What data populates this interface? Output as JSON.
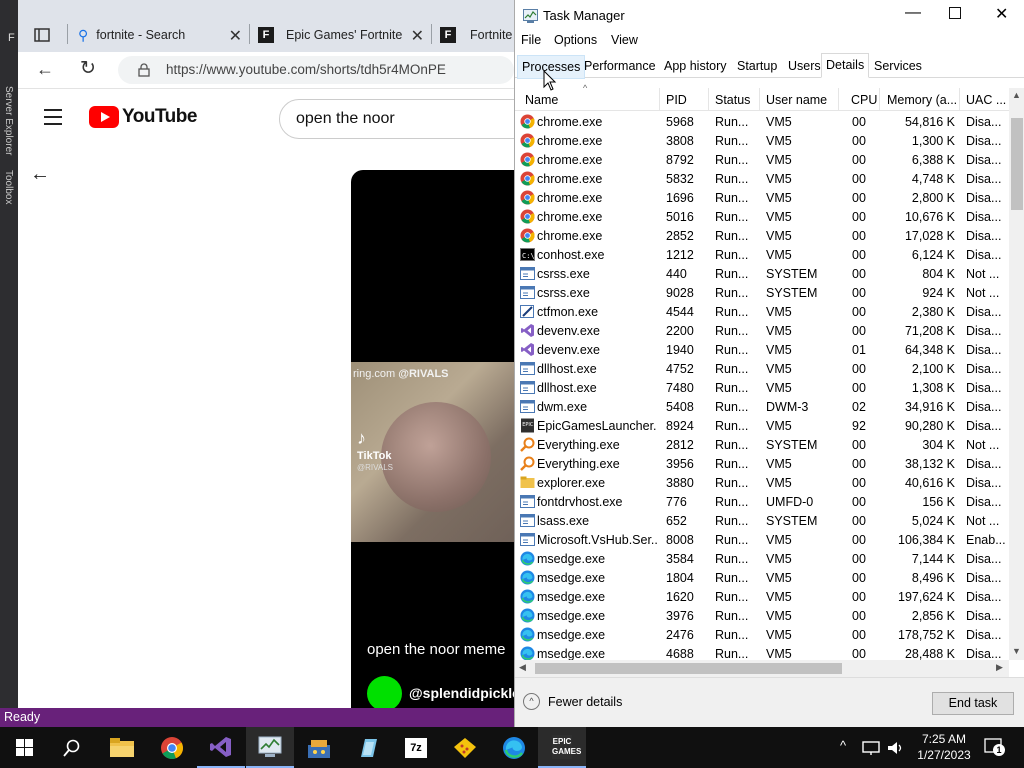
{
  "vs": {
    "side_labels": [
      "Server Explorer",
      "Toolbox"
    ],
    "partial_menu": "F"
  },
  "browser": {
    "tabs": [
      {
        "label": "fortnite - Search",
        "icon": "search-icon"
      },
      {
        "label": "Epic Games' Fortnite",
        "icon": "fortnite-icon"
      },
      {
        "label": "Fortnite",
        "icon": "fortnite-icon"
      }
    ],
    "url": "https://www.youtube.com/shorts/tdh5r4MOnPE",
    "youtube": {
      "logo": "YouTube",
      "search_value": "open the noor",
      "short_caption": "open the noor meme",
      "short_user": "@splendidpickle",
      "watermark_site": "ring.com",
      "watermark_handle": "@RIVALS",
      "tiktok_label": "TikTok",
      "tiktok_handle": "@RIVALS"
    }
  },
  "taskmanager": {
    "title": "Task Manager",
    "menu": [
      "File",
      "Options",
      "View"
    ],
    "tabs": [
      "Processes",
      "Performance",
      "App history",
      "Startup",
      "Users",
      "Details",
      "Services"
    ],
    "active_tab": "Details",
    "columns": [
      "Name",
      "PID",
      "Status",
      "User name",
      "CPU",
      "Memory (a...",
      "UAC ..."
    ],
    "rows": [
      {
        "icon": "chrome",
        "name": "chrome.exe",
        "pid": "5968",
        "status": "Run...",
        "user": "VM5",
        "cpu": "00",
        "mem": "54,816 K",
        "uac": "Disa..."
      },
      {
        "icon": "chrome",
        "name": "chrome.exe",
        "pid": "3808",
        "status": "Run...",
        "user": "VM5",
        "cpu": "00",
        "mem": "1,300 K",
        "uac": "Disa..."
      },
      {
        "icon": "chrome",
        "name": "chrome.exe",
        "pid": "8792",
        "status": "Run...",
        "user": "VM5",
        "cpu": "00",
        "mem": "6,388 K",
        "uac": "Disa..."
      },
      {
        "icon": "chrome",
        "name": "chrome.exe",
        "pid": "5832",
        "status": "Run...",
        "user": "VM5",
        "cpu": "00",
        "mem": "4,748 K",
        "uac": "Disa..."
      },
      {
        "icon": "chrome",
        "name": "chrome.exe",
        "pid": "1696",
        "status": "Run...",
        "user": "VM5",
        "cpu": "00",
        "mem": "2,800 K",
        "uac": "Disa..."
      },
      {
        "icon": "chrome",
        "name": "chrome.exe",
        "pid": "5016",
        "status": "Run...",
        "user": "VM5",
        "cpu": "00",
        "mem": "10,676 K",
        "uac": "Disa..."
      },
      {
        "icon": "chrome",
        "name": "chrome.exe",
        "pid": "2852",
        "status": "Run...",
        "user": "VM5",
        "cpu": "00",
        "mem": "17,028 K",
        "uac": "Disa..."
      },
      {
        "icon": "console",
        "name": "conhost.exe",
        "pid": "1212",
        "status": "Run...",
        "user": "VM5",
        "cpu": "00",
        "mem": "6,124 K",
        "uac": "Disa..."
      },
      {
        "icon": "window",
        "name": "csrss.exe",
        "pid": "440",
        "status": "Run...",
        "user": "SYSTEM",
        "cpu": "00",
        "mem": "804 K",
        "uac": "Not ..."
      },
      {
        "icon": "window",
        "name": "csrss.exe",
        "pid": "9028",
        "status": "Run...",
        "user": "SYSTEM",
        "cpu": "00",
        "mem": "924 K",
        "uac": "Not ..."
      },
      {
        "icon": "pen",
        "name": "ctfmon.exe",
        "pid": "4544",
        "status": "Run...",
        "user": "VM5",
        "cpu": "00",
        "mem": "2,380 K",
        "uac": "Disa..."
      },
      {
        "icon": "vs",
        "name": "devenv.exe",
        "pid": "2200",
        "status": "Run...",
        "user": "VM5",
        "cpu": "00",
        "mem": "71,208 K",
        "uac": "Disa..."
      },
      {
        "icon": "vs",
        "name": "devenv.exe",
        "pid": "1940",
        "status": "Run...",
        "user": "VM5",
        "cpu": "01",
        "mem": "64,348 K",
        "uac": "Disa..."
      },
      {
        "icon": "window",
        "name": "dllhost.exe",
        "pid": "4752",
        "status": "Run...",
        "user": "VM5",
        "cpu": "00",
        "mem": "2,100 K",
        "uac": "Disa..."
      },
      {
        "icon": "window",
        "name": "dllhost.exe",
        "pid": "7480",
        "status": "Run...",
        "user": "VM5",
        "cpu": "00",
        "mem": "1,308 K",
        "uac": "Disa..."
      },
      {
        "icon": "window",
        "name": "dwm.exe",
        "pid": "5408",
        "status": "Run...",
        "user": "DWM-3",
        "cpu": "02",
        "mem": "34,916 K",
        "uac": "Disa..."
      },
      {
        "icon": "epic",
        "name": "EpicGamesLauncher....",
        "pid": "8924",
        "status": "Run...",
        "user": "VM5",
        "cpu": "92",
        "mem": "90,280 K",
        "uac": "Disa..."
      },
      {
        "icon": "search",
        "name": "Everything.exe",
        "pid": "2812",
        "status": "Run...",
        "user": "SYSTEM",
        "cpu": "00",
        "mem": "304 K",
        "uac": "Not ..."
      },
      {
        "icon": "search",
        "name": "Everything.exe",
        "pid": "3956",
        "status": "Run...",
        "user": "VM5",
        "cpu": "00",
        "mem": "38,132 K",
        "uac": "Disa..."
      },
      {
        "icon": "folder",
        "name": "explorer.exe",
        "pid": "3880",
        "status": "Run...",
        "user": "VM5",
        "cpu": "00",
        "mem": "40,616 K",
        "uac": "Disa..."
      },
      {
        "icon": "window",
        "name": "fontdrvhost.exe",
        "pid": "776",
        "status": "Run...",
        "user": "UMFD-0",
        "cpu": "00",
        "mem": "156 K",
        "uac": "Disa..."
      },
      {
        "icon": "window",
        "name": "lsass.exe",
        "pid": "652",
        "status": "Run...",
        "user": "SYSTEM",
        "cpu": "00",
        "mem": "5,024 K",
        "uac": "Not ..."
      },
      {
        "icon": "window",
        "name": "Microsoft.VsHub.Ser...",
        "pid": "8008",
        "status": "Run...",
        "user": "VM5",
        "cpu": "00",
        "mem": "106,384 K",
        "uac": "Enab..."
      },
      {
        "icon": "edge",
        "name": "msedge.exe",
        "pid": "3584",
        "status": "Run...",
        "user": "VM5",
        "cpu": "00",
        "mem": "7,144 K",
        "uac": "Disa..."
      },
      {
        "icon": "edge",
        "name": "msedge.exe",
        "pid": "1804",
        "status": "Run...",
        "user": "VM5",
        "cpu": "00",
        "mem": "8,496 K",
        "uac": "Disa..."
      },
      {
        "icon": "edge",
        "name": "msedge.exe",
        "pid": "1620",
        "status": "Run...",
        "user": "VM5",
        "cpu": "00",
        "mem": "197,624 K",
        "uac": "Disa..."
      },
      {
        "icon": "edge",
        "name": "msedge.exe",
        "pid": "3976",
        "status": "Run...",
        "user": "VM5",
        "cpu": "00",
        "mem": "2,856 K",
        "uac": "Disa..."
      },
      {
        "icon": "edge",
        "name": "msedge.exe",
        "pid": "2476",
        "status": "Run...",
        "user": "VM5",
        "cpu": "00",
        "mem": "178,752 K",
        "uac": "Disa..."
      },
      {
        "icon": "edge",
        "name": "msedge.exe",
        "pid": "4688",
        "status": "Run...",
        "user": "VM5",
        "cpu": "00",
        "mem": "28,488 K",
        "uac": "Disa..."
      }
    ],
    "fewer_details": "Fewer details",
    "end_task": "End task"
  },
  "status_bar": {
    "text": "Ready"
  },
  "taskbar": {
    "time": "7:25 AM",
    "date": "1/27/2023",
    "notification_count": "1",
    "pinned": [
      "windows-start-icon",
      "search-icon",
      "file-explorer-icon",
      "chrome-icon",
      "visual-studio-icon",
      "task-manager-icon",
      "app-icon",
      "notepad-icon",
      "7zip-icon",
      "fortnite-icon",
      "edge-icon",
      "epic-games-icon"
    ]
  },
  "colors": {
    "vs_purple": "#68217a",
    "youtube_red": "#ff0000",
    "accent_blue": "#0078d7"
  }
}
